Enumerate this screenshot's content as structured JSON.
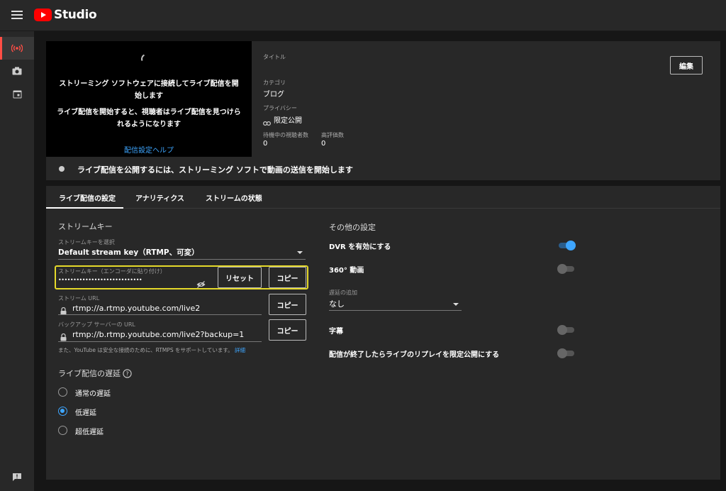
{
  "header": {
    "logo_text": "Studio"
  },
  "preview": {
    "message1": "ストリーミング ソフトウェアに接続してライブ配信を開始します",
    "message2": "ライブ配信を開始すると、視聴者はライブ配信を見つけられるようになります",
    "help_link": "配信設定ヘルプ"
  },
  "info": {
    "title_label": "タイトル",
    "category_label": "カテゴリ",
    "category_value": "ブログ",
    "privacy_label": "プライバシー",
    "privacy_value": "限定公開",
    "viewers_label": "待機中の視聴者数",
    "viewers_value": "0",
    "likes_label": "高評価数",
    "likes_value": "0",
    "edit_label": "編集"
  },
  "status": {
    "text": "ライブ配信を公開するには、ストリーミング ソフトで動画の送信を開始します"
  },
  "tabs": [
    {
      "label": "ライブ配信の設定"
    },
    {
      "label": "アナリティクス"
    },
    {
      "label": "ストリームの状態"
    }
  ],
  "stream_key": {
    "section_title": "ストリームキー",
    "select_label": "ストリームキーを選択",
    "select_value": "Default stream key（RTMP、可変）",
    "key_label": "ストリームキー（エンコーダに貼り付け）",
    "key_value": "••••••••••••••••••••••••••••",
    "reset_label": "リセット",
    "copy_label": "コピー",
    "url_label": "ストリーム URL",
    "url_value": "rtmp://a.rtmp.youtube.com/live2",
    "backup_label": "バックアップ サーバーの URL",
    "backup_value": "rtmp://b.rtmp.youtube.com/live2?backup=1",
    "note": "また、YouTube は安全な接続のために、RTMPS をサポートしています。",
    "note_link": "詳細"
  },
  "latency": {
    "title": "ライブ配信の遅延",
    "options": [
      {
        "label": "通常の遅延",
        "checked": false
      },
      {
        "label": "低遅延",
        "checked": true
      },
      {
        "label": "超低遅延",
        "checked": false
      }
    ]
  },
  "other": {
    "title": "その他の設定",
    "dvr_label": "DVR を有効にする",
    "dvr_on": true,
    "v360_label": "360° 動画",
    "v360_on": false,
    "delay_label": "遅延の追加",
    "delay_value": "なし",
    "captions_label": "字幕",
    "captions_on": false,
    "replay_label": "配信が終了したらライブのリプレイを限定公開にする",
    "replay_on": false
  },
  "colors": {
    "accent": "#3ea6ff",
    "brand": "#ff0000",
    "highlight": "#e5d92a"
  }
}
